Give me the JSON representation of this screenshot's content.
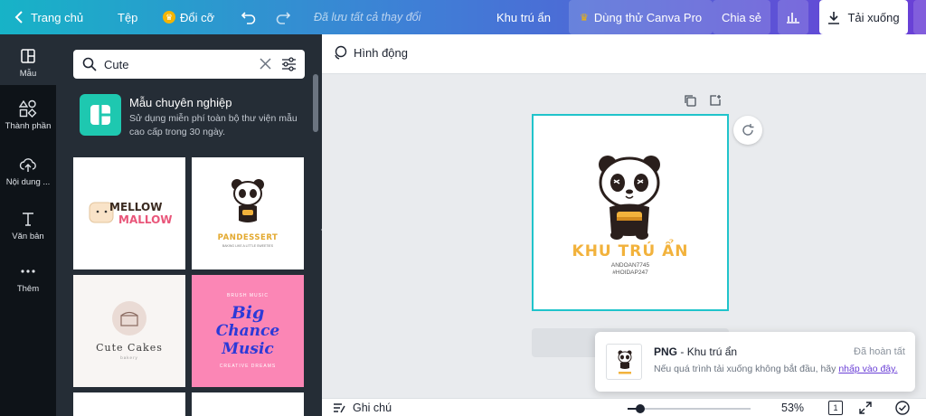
{
  "topbar": {
    "home": "Trang chủ",
    "file": "Tệp",
    "resize": "Đổi cỡ",
    "saved": "Đã lưu tất cả thay đổi",
    "design_title": "Khu trú ẩn",
    "try_pro": "Dùng thử Canva Pro",
    "share": "Chia sẻ",
    "download": "Tải xuống"
  },
  "rail": {
    "templates": "Mẫu",
    "elements": "Thành phần",
    "uploads": "Nội dung ...",
    "text": "Văn bản",
    "more": "Thêm"
  },
  "panel": {
    "search_value": "Cute",
    "promo_title": "Mẫu chuyên nghiệp",
    "promo_desc": "Sử dụng miễn phí toàn bộ thư viện mẫu cao cấp trong 30 ngày.",
    "templates": [
      {
        "line1": "MELLOW",
        "line2": "MALLOW"
      },
      {
        "line1": "PANDESSERT",
        "line2": "BAKING LIKE A LITTLE SWEETIES"
      },
      {
        "line1": "Cute Cakes",
        "line2": "bakery"
      },
      {
        "line1": "Big",
        "line2": "Chance",
        "line3": "Music",
        "line4": "BRUSH MUSIC",
        "line5": "CREATIVE DREAMS"
      }
    ]
  },
  "editor": {
    "animate": "Hình động",
    "canvas_name": "KHU TRÚ ẨN",
    "canvas_sub1": "ANDOAN7745",
    "canvas_sub2": "#HOIDAP247"
  },
  "toast": {
    "format": "PNG",
    "separator": " - ",
    "name": "Khu trú ẩn",
    "status": "Đã hoàn tất",
    "help": "Nếu quá trình tải xuống không bắt đầu, hãy ",
    "link": "nhấp vào đây."
  },
  "bottombar": {
    "notes": "Ghi chú",
    "zoom": "53%",
    "zoom_fraction": 0.1,
    "pages": "1"
  },
  "colors": {
    "accent": "#20c4cb",
    "purple": "#6a3fd6",
    "panel_bg": "#252d36",
    "rail_bg": "#0e1318",
    "brand_yellow": "#f2b23c"
  }
}
